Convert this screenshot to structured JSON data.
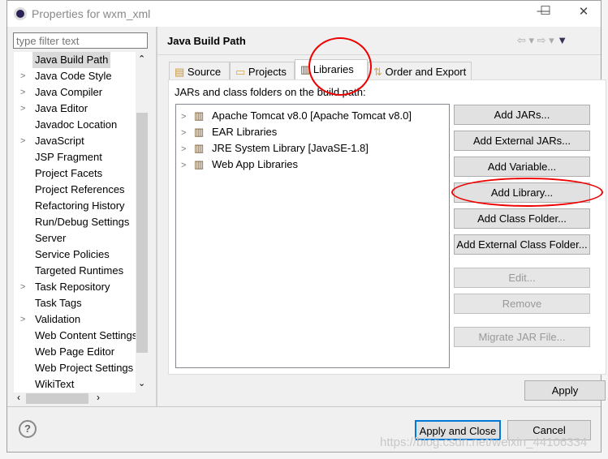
{
  "window": {
    "title": "Properties for wxm_xml",
    "minimize": "—",
    "maximize": "☐",
    "close": "✕"
  },
  "sidebar": {
    "filter_placeholder": "type filter text",
    "items": [
      {
        "label": "Java Build Path",
        "expandable": false,
        "selected": true
      },
      {
        "label": "Java Code Style",
        "expandable": true
      },
      {
        "label": "Java Compiler",
        "expandable": true
      },
      {
        "label": "Java Editor",
        "expandable": true
      },
      {
        "label": "Javadoc Location",
        "expandable": false
      },
      {
        "label": "JavaScript",
        "expandable": true
      },
      {
        "label": "JSP Fragment",
        "expandable": false
      },
      {
        "label": "Project Facets",
        "expandable": false
      },
      {
        "label": "Project References",
        "expandable": false
      },
      {
        "label": "Refactoring History",
        "expandable": false
      },
      {
        "label": "Run/Debug Settings",
        "expandable": false
      },
      {
        "label": "Server",
        "expandable": false
      },
      {
        "label": "Service Policies",
        "expandable": false
      },
      {
        "label": "Targeted Runtimes",
        "expandable": false
      },
      {
        "label": "Task Repository",
        "expandable": true
      },
      {
        "label": "Task Tags",
        "expandable": false
      },
      {
        "label": "Validation",
        "expandable": true
      },
      {
        "label": "Web Content Settings",
        "expandable": false
      },
      {
        "label": "Web Page Editor",
        "expandable": false
      },
      {
        "label": "Web Project Settings",
        "expandable": false
      },
      {
        "label": "WikiText",
        "expandable": false
      }
    ]
  },
  "page": {
    "title": "Java Build Path",
    "tabs": [
      {
        "label": "Source"
      },
      {
        "label": "Projects"
      },
      {
        "label": "Libraries",
        "active": true
      },
      {
        "label": "Order and Export"
      }
    ],
    "list_label": "JARs and class folders on the build path:",
    "libraries": [
      "Apache Tomcat v8.0 [Apache Tomcat v8.0]",
      "EAR Libraries",
      "JRE System Library [JavaSE-1.8]",
      "Web App Libraries"
    ],
    "buttons": [
      {
        "label": "Add JARs...",
        "enabled": true
      },
      {
        "label": "Add External JARs...",
        "enabled": true
      },
      {
        "label": "Add Variable...",
        "enabled": true
      },
      {
        "label": "Add Library...",
        "enabled": true
      },
      {
        "label": "Add Class Folder...",
        "enabled": true
      },
      {
        "label": "Add External Class Folder...",
        "enabled": true
      },
      {
        "label": "Edit...",
        "enabled": false
      },
      {
        "label": "Remove",
        "enabled": false
      },
      {
        "label": "Migrate JAR File...",
        "enabled": false
      }
    ],
    "apply": "Apply"
  },
  "footer": {
    "apply_close": "Apply and Close",
    "cancel": "Cancel"
  },
  "watermark": "https://blog.csdn.net/weixin_44106334",
  "colors": {
    "annotation": "#e00000",
    "default_button_border": "#0078d7"
  }
}
